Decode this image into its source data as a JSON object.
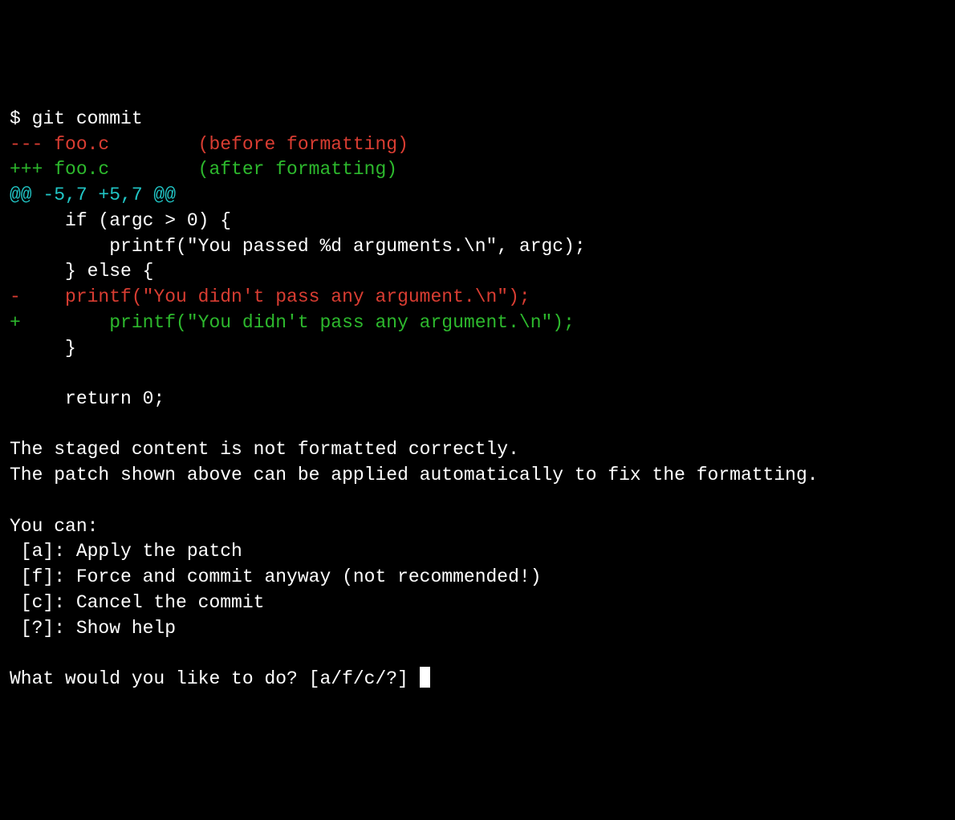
{
  "prompt_symbol": "$ ",
  "command": "git commit",
  "diff": {
    "minus_header": "--- foo.c        (before formatting)",
    "plus_header": "+++ foo.c        (after formatting)",
    "hunk": "@@ -5,7 +5,7 @@",
    "context1": "     if (argc > 0) {",
    "context2": "         printf(\"You passed %d arguments.\\n\", argc);",
    "context3": "     } else {",
    "removed": "-    printf(\"You didn't pass any argument.\\n\");",
    "added": "+        printf(\"You didn't pass any argument.\\n\");",
    "context4": "     }",
    "context5": "",
    "context6": "     return 0;"
  },
  "message": {
    "line1": "The staged content is not formatted correctly.",
    "line2": "The patch shown above can be applied automatically to fix the formatting."
  },
  "options": {
    "header": "You can:",
    "a": " [a]: Apply the patch",
    "f": " [f]: Force and commit anyway (not recommended!)",
    "c": " [c]: Cancel the commit",
    "help": " [?]: Show help"
  },
  "question": "What would you like to do? [a/f/c/?] "
}
